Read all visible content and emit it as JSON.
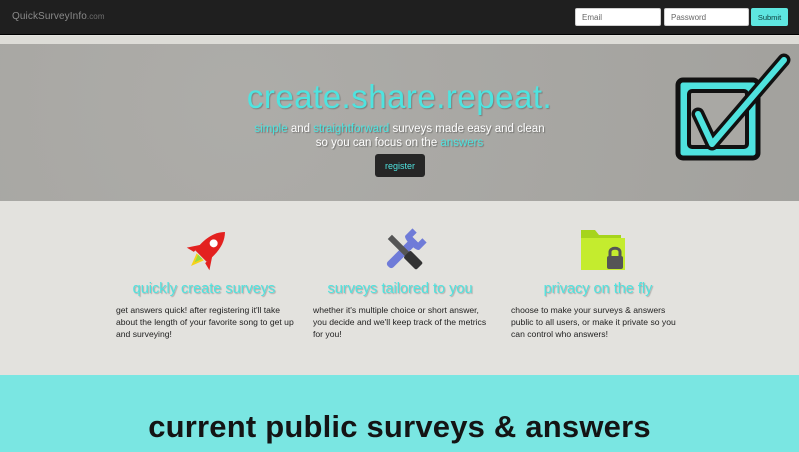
{
  "navbar": {
    "brand_main": "QuickSurveyInfo",
    "brand_tld": ".com",
    "email_placeholder": "Email",
    "password_placeholder": "Password",
    "submit_label": "Submit"
  },
  "hero": {
    "title": "create.share.repeat.",
    "sub_word1": "simple",
    "sub_and": " and ",
    "sub_word2": "straightforward",
    "sub_rest1": " surveys made easy and clean",
    "sub_line2_a": "so you can focus on the ",
    "sub_word3": "answers",
    "register_label": "register",
    "icon": "checkbox-icon"
  },
  "features": [
    {
      "icon": "rocket-icon",
      "title": "quickly create surveys",
      "text": "get answers quick! after registering it'll take about the length of your favorite song to get up and surveying!"
    },
    {
      "icon": "tools-icon",
      "title": "surveys tailored to you",
      "text": "whether it's multiple choice or short answer, you decide and we'll keep track of the metrics for you!"
    },
    {
      "icon": "locked-folder-icon",
      "title": "privacy on the fly",
      "text": "choose to make your surveys & answers public to all users, or make it private so you can control who answers!"
    }
  ],
  "public": {
    "title": "current public surveys & answers"
  },
  "colors": {
    "accent": "#4fe3df",
    "navbar": "#1f1f1f",
    "hero_bg": "#a9a8a4",
    "bottom_bg": "#7ae6e2"
  }
}
